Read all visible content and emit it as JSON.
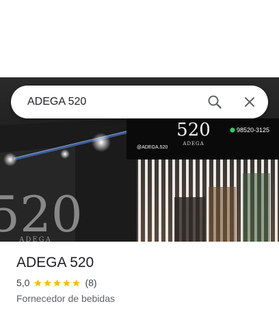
{
  "search": {
    "query": "ADEGA 520"
  },
  "photo": {
    "sign_number": "520",
    "sign_name": "ADEGA",
    "handle": "@ADEGA.520",
    "phone": "98520-3125",
    "wall_number": "520",
    "wall_name": "ADEGA"
  },
  "place": {
    "name": "ADEGA 520",
    "rating": "5,0",
    "rating_value": 5,
    "review_count": "(8)",
    "category": "Fornecedor de bebidas"
  },
  "colors": {
    "star": "#fbbc04",
    "text": "#202124",
    "secondary": "#5f6368"
  }
}
